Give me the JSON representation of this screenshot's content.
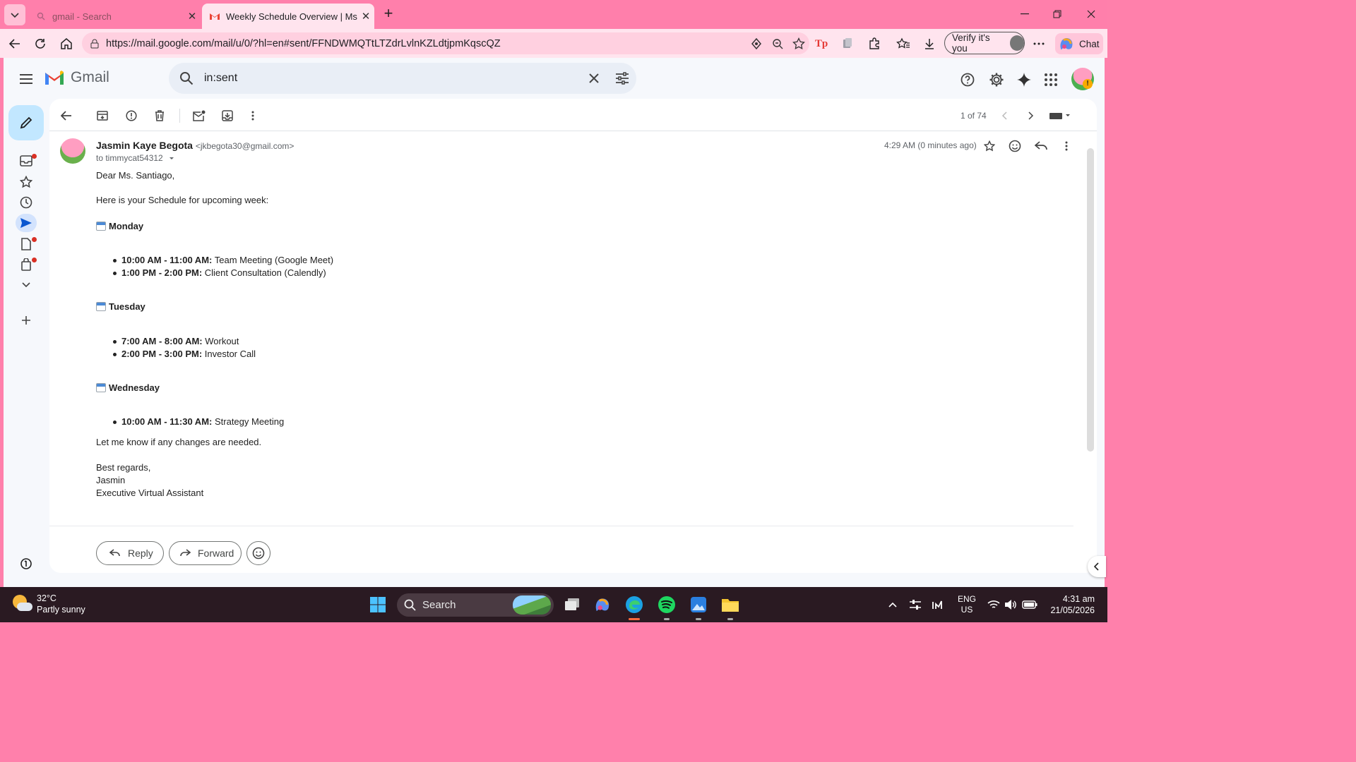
{
  "browser": {
    "tabs": [
      {
        "title": "gmail - Search",
        "active": false
      },
      {
        "title": "Weekly Schedule Overview | Ms. R",
        "active": true
      }
    ],
    "url": "https://mail.google.com/mail/u/0/?hl=en#sent/FFNDWMQTtLTZdrLvlnKZLdtjpmKqscQZ",
    "verify_label": "Verify it's you",
    "chat_label": "Chat"
  },
  "gmail": {
    "brand": "Gmail",
    "search_query": "in:sent",
    "pager": "1 of 74",
    "message": {
      "sender_name": "Jasmin Kaye Begota",
      "sender_email": "<jkbegota30@gmail.com>",
      "to": "to timmycat54312",
      "time": "4:29 AM (0 minutes ago)",
      "greeting": "Dear Ms. Santiago,",
      "intro": "Here is your Schedule for upcoming week:",
      "days": [
        {
          "name": "Monday",
          "items": [
            {
              "time": "10:00 AM - 11:00 AM:",
              "desc": " Team Meeting (Google Meet)"
            },
            {
              "time": "1:00 PM - 2:00 PM:",
              "desc": " Client Consultation (Calendly)"
            }
          ]
        },
        {
          "name": "Tuesday",
          "items": [
            {
              "time": "7:00 AM - 8:00 AM:",
              "desc": " Workout"
            },
            {
              "time": "2:00 PM - 3:00 PM:",
              "desc": " Investor Call"
            }
          ]
        },
        {
          "name": "Wednesday",
          "items": [
            {
              "time": "10:00 AM - 11:30 AM:",
              "desc": " Strategy Meeting"
            }
          ]
        }
      ],
      "closing": "Let me know if any changes are needed.",
      "signoff": "Best regards,",
      "signature_name": "Jasmin",
      "signature_title": "Executive Virtual Assistant"
    },
    "reply_label": "Reply",
    "forward_label": "Forward"
  },
  "taskbar": {
    "temperature": "32°C",
    "weather": "Partly sunny",
    "search_label": "Search",
    "lang_top": "ENG",
    "lang_bottom": "US",
    "time": "4:31 am",
    "date": "21/05/2026"
  },
  "colors": {
    "browser_frame": "#ff7fab",
    "tab_active": "#ffe4ee",
    "compose": "#c2e7ff",
    "unread_dot": "#d93025"
  }
}
